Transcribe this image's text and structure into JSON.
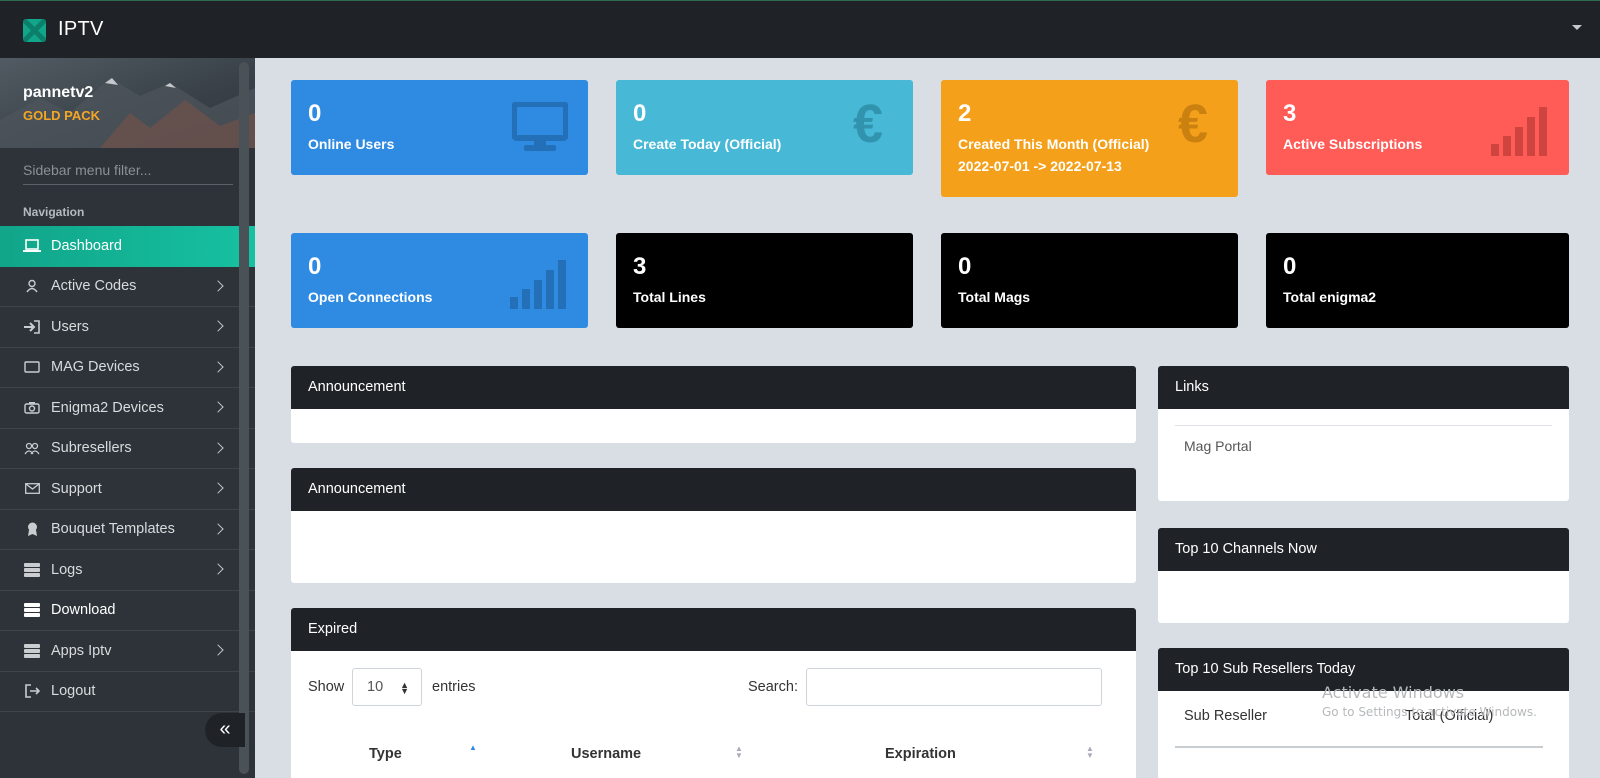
{
  "app": {
    "brand": "IPTV"
  },
  "sidebar": {
    "username": "pannetv2",
    "pack": "GOLD PACK",
    "filter_placeholder": "Sidebar menu filter...",
    "nav_heading": "Navigation",
    "items": [
      {
        "label": "Dashboard",
        "icon": "laptop-icon",
        "active": true
      },
      {
        "label": "Active Codes",
        "icon": "user-icon"
      },
      {
        "label": "Users",
        "icon": "sign-in-icon"
      },
      {
        "label": "MAG Devices",
        "icon": "monitor-icon"
      },
      {
        "label": "Enigma2 Devices",
        "icon": "camera-icon"
      },
      {
        "label": "Subresellers",
        "icon": "users-icon"
      },
      {
        "label": "Support",
        "icon": "envelope-icon"
      },
      {
        "label": "Bouquet Templates",
        "icon": "award-icon"
      },
      {
        "label": "Logs",
        "icon": "server-icon"
      },
      {
        "label": "Download",
        "icon": "server-icon"
      },
      {
        "label": "Apps Iptv",
        "icon": "server-icon"
      },
      {
        "label": "Logout",
        "icon": "logout-icon"
      }
    ],
    "collapse_glyph": "«"
  },
  "stats": [
    {
      "value": "0",
      "label": "Online Users",
      "color": "#2f8be2",
      "icon": "monitor-icon"
    },
    {
      "value": "0",
      "label": "Create Today (Official)",
      "color": "#47b8d6",
      "icon": "euro-icon"
    },
    {
      "value": "2",
      "label": "Created This Month (Official)",
      "sublabel": "2022-07-01 -> 2022-07-13",
      "color": "#f5a01a",
      "icon": "euro-icon"
    },
    {
      "value": "3",
      "label": "Active Subscriptions",
      "color": "#ff5b57",
      "icon": "signal-icon"
    },
    {
      "value": "0",
      "label": "Open Connections",
      "color": "#2f8be2",
      "icon": "signal-icon"
    },
    {
      "value": "3",
      "label": "Total Lines",
      "color": "#000000"
    },
    {
      "value": "0",
      "label": "Total Mags",
      "color": "#000000"
    },
    {
      "value": "0",
      "label": "Total enigma2",
      "color": "#000000"
    }
  ],
  "panels": {
    "announcement1": "Announcement",
    "announcement2": "Announcement",
    "expired": {
      "title": "Expired",
      "show_label": "Show",
      "entries_value": "10",
      "entries_label": "entries",
      "search_label": "Search:",
      "columns": [
        "Type",
        "Username",
        "Expiration"
      ]
    },
    "links": {
      "title": "Links",
      "items": [
        "Mag Portal"
      ]
    },
    "top_channels": "Top 10 Channels Now",
    "top_subresellers": {
      "title": "Top 10 Sub Resellers Today",
      "columns": [
        "Sub Reseller",
        "Total (Official)"
      ]
    }
  },
  "watermark": {
    "line1": "Activate Windows",
    "line2": "Go to Settings to activate Windows."
  }
}
